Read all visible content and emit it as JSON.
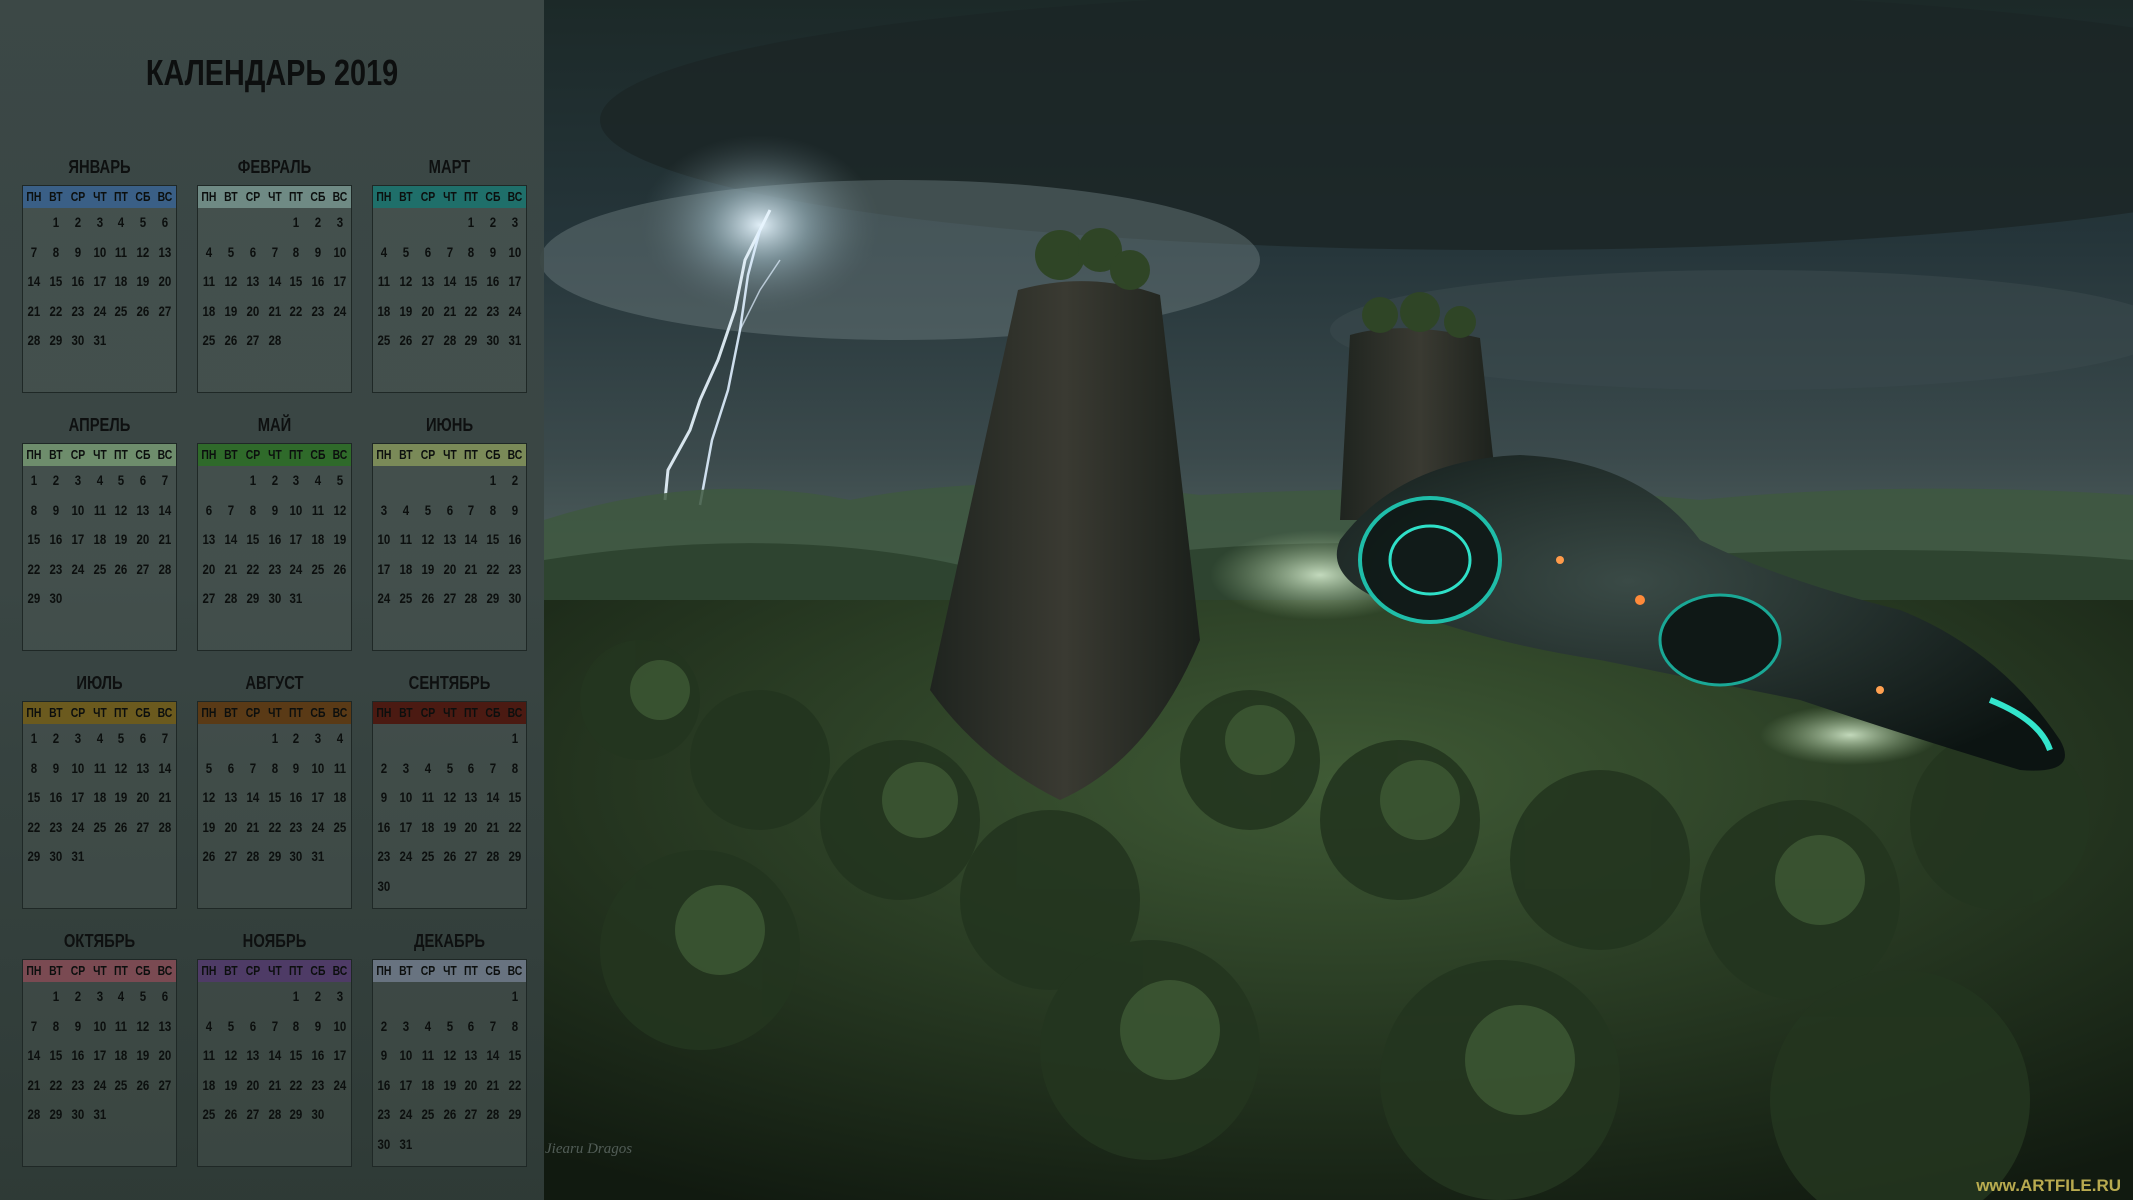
{
  "calendar": {
    "title": "КАЛЕНДАРЬ 2019",
    "weekdays": [
      "ПН",
      "ВТ",
      "СР",
      "ЧТ",
      "ПТ",
      "СБ",
      "ВС"
    ],
    "months": [
      {
        "name": "ЯНВАРЬ",
        "start": 1,
        "days": 31,
        "color": "#3a5f86"
      },
      {
        "name": "ФЕВРАЛЬ",
        "start": 4,
        "days": 28,
        "color": "#6f8a84"
      },
      {
        "name": "МАРТ",
        "start": 4,
        "days": 31,
        "color": "#1f6f6a"
      },
      {
        "name": "АПРЕЛЬ",
        "start": 0,
        "days": 30,
        "color": "#6e8d6c"
      },
      {
        "name": "МАЙ",
        "start": 2,
        "days": 31,
        "color": "#2f6a2a"
      },
      {
        "name": "ИЮНЬ",
        "start": 5,
        "days": 30,
        "color": "#7a8a58"
      },
      {
        "name": "ИЮЛЬ",
        "start": 0,
        "days": 31,
        "color": "#6b5a1e"
      },
      {
        "name": "АВГУСТ",
        "start": 3,
        "days": 31,
        "color": "#5a3a16"
      },
      {
        "name": "СЕНТЯБРЬ",
        "start": 6,
        "days": 30,
        "color": "#4b1a12"
      },
      {
        "name": "ОКТЯБРЬ",
        "start": 1,
        "days": 31,
        "color": "#7a4a52"
      },
      {
        "name": "НОЯБРЬ",
        "start": 4,
        "days": 30,
        "color": "#4e3b66"
      },
      {
        "name": "ДЕКАБРЬ",
        "start": 6,
        "days": 31,
        "color": "#687380"
      }
    ]
  },
  "signature": "Jiearu Dragos",
  "watermark": "www.ARTFILE.RU"
}
